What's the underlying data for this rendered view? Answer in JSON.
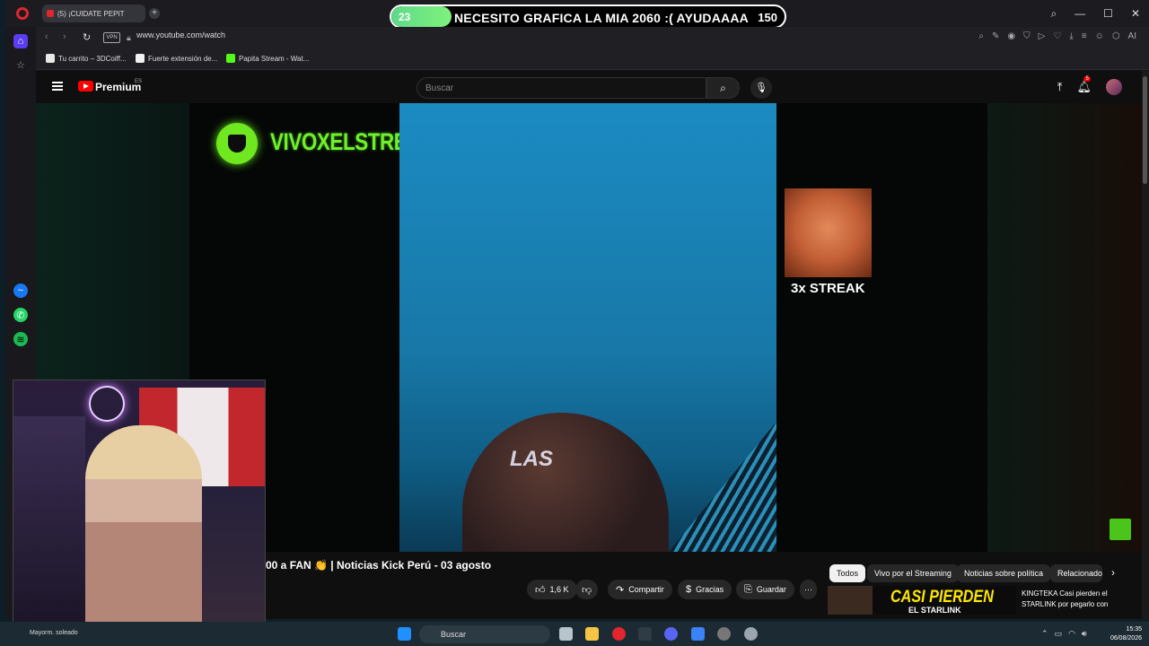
{
  "stream_goal": {
    "current": "23",
    "text": "NECESITO GRAFICA LA MIA 2060 :( AYUDAAAA",
    "max": "150",
    "progress_fraction": 0.153
  },
  "browser": {
    "tab_label": "(5) ¡CUIDATE PEPIT",
    "tab_audio_icon": "speaker-icon",
    "url": "www.youtube.com/watch",
    "vpn_label": "VPN",
    "bookmarks": [
      {
        "label": "Tu carrito – 3DCoiff...",
        "color": "#e8e8e8"
      },
      {
        "label": "Fuerte extensión de...",
        "color": "#f2f2f2"
      },
      {
        "label": "Papita Stream - Wat...",
        "color": "#53fc18"
      }
    ]
  },
  "youtube": {
    "brand": "Premium",
    "region": "ES",
    "search_placeholder": "Buscar",
    "notification_count": "5",
    "video_title": "00 a FAN 👏 | Noticias Kick Perú - 03 agosto",
    "likes": "1,6 K",
    "share_label": "Compartir",
    "thanks_label": "Gracias",
    "save_label": "Guardar",
    "more_label": "···",
    "chips": [
      "Todos",
      "Vivo por el Streaming",
      "Noticias sobre política",
      "Relacionado"
    ],
    "rec": {
      "thumb_text": "CASI PIERDEN",
      "thumb_sub": "EL STARLINK",
      "title": "KINGTEKA Casi pierden el STARLINK por pegarlo con"
    }
  },
  "overlay": {
    "channel": "VIVOXELSTREAMING",
    "streak": "3x STREAK",
    "caption": "LAS"
  },
  "taskbar": {
    "weather": "Mayorm. soleado",
    "search_placeholder": "Buscar",
    "time": "15:35",
    "date": "06/08/2026"
  },
  "colors": {
    "accent_green": "#6ff02d",
    "yt_red": "#ff0000",
    "opera_red": "#e0262e"
  }
}
